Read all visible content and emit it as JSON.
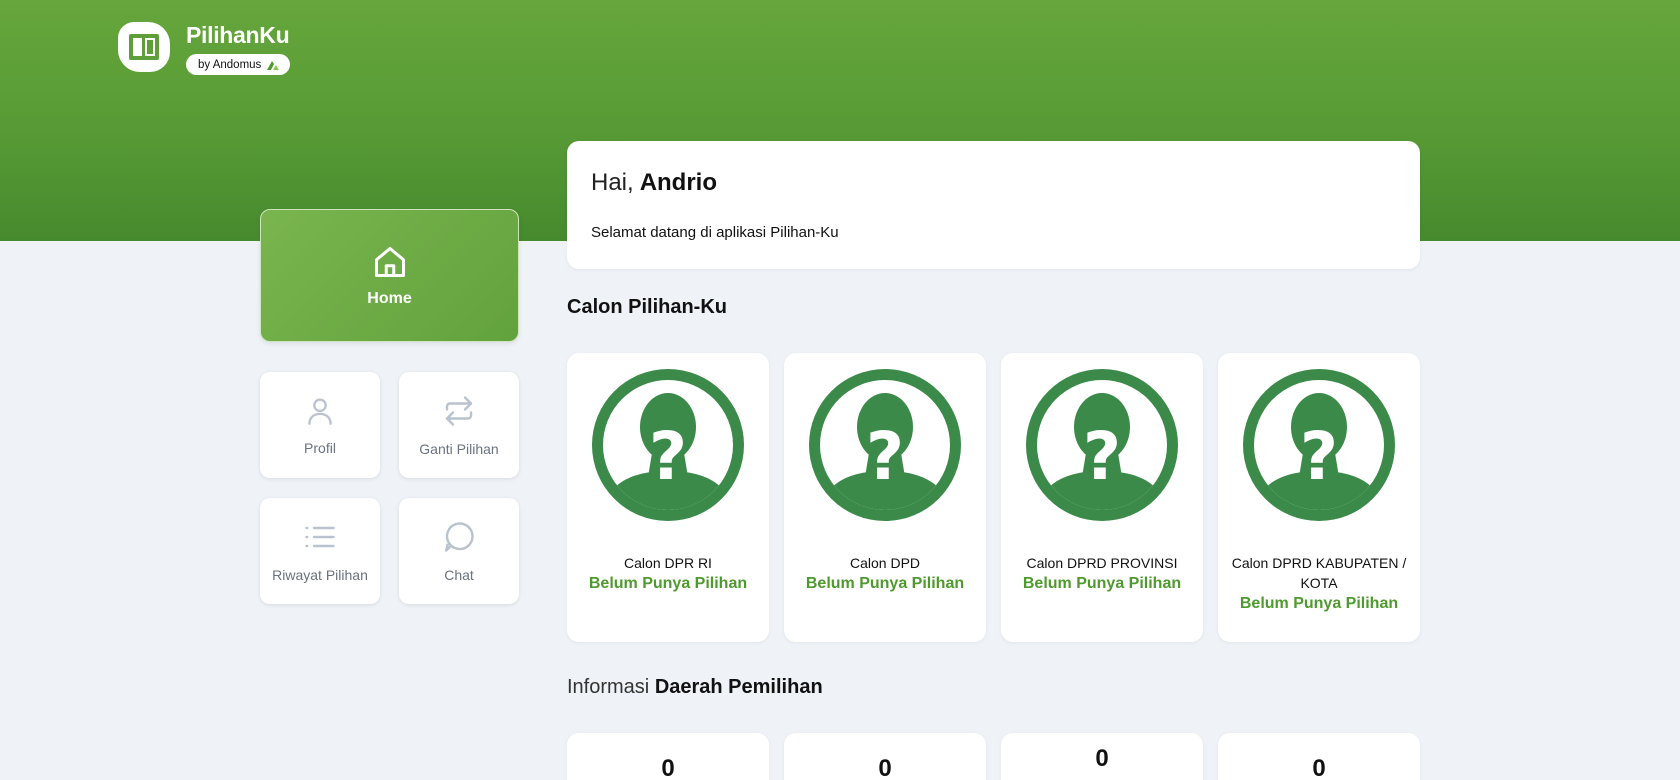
{
  "brand": {
    "name": "PilihanKu",
    "badge": "by Andomus"
  },
  "sidebar": {
    "home": "Home",
    "items": [
      {
        "label": "Profil",
        "icon": "user-icon"
      },
      {
        "label": "Ganti Pilihan",
        "icon": "swap-icon"
      },
      {
        "label": "Riwayat Pilihan",
        "icon": "list-icon"
      },
      {
        "label": "Chat",
        "icon": "chat-bubble-icon"
      }
    ]
  },
  "greeting": {
    "prefix": "Hai,",
    "name": "Andrio",
    "subtitle": "Selamat datang di aplikasi Pilihan-Ku"
  },
  "candidates": {
    "title": "Calon Pilihan-Ku",
    "cards": [
      {
        "label": "Calon DPR RI",
        "status": "Belum Punya Pilihan"
      },
      {
        "label": "Calon DPD",
        "status": "Belum Punya Pilihan"
      },
      {
        "label": "Calon DPRD PROVINSI",
        "status": "Belum Punya Pilihan"
      },
      {
        "label": "Calon DPRD KABUPATEN / KOTA",
        "status": "Belum Punya Pilihan"
      }
    ]
  },
  "dapil": {
    "title_light": "Informasi",
    "title_bold": "Daerah Pemilihan",
    "values": [
      "0",
      "0",
      "0",
      "0"
    ]
  },
  "colors": {
    "brand_green": "#5f9f3a",
    "status_green": "#4f9a2f",
    "avatar_green": "#3b8a4a",
    "background": "#eff3f8"
  }
}
